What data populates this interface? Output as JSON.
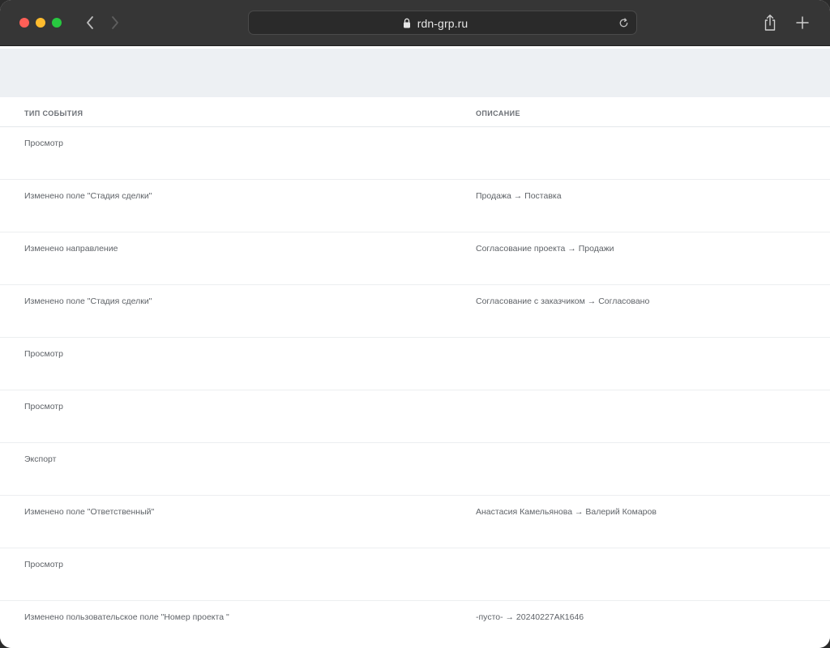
{
  "browser": {
    "url": "rdn-grp.ru"
  },
  "table": {
    "headers": [
      "Тип события",
      "Описание"
    ],
    "rows": [
      {
        "type": "Просмотр",
        "description": ""
      },
      {
        "type": "Изменено поле \"Стадия сделки\"",
        "description": "Продажа → Поставка"
      },
      {
        "type": "Изменено направление",
        "description": "Согласование проекта → Продажи"
      },
      {
        "type": "Изменено поле \"Стадия сделки\"",
        "description": "Согласование с заказчиком → Согласовано"
      },
      {
        "type": "Просмотр",
        "description": ""
      },
      {
        "type": "Просмотр",
        "description": ""
      },
      {
        "type": "Экспорт",
        "description": ""
      },
      {
        "type": "Изменено поле \"Ответственный\"",
        "description": "Анастасия Камельянова → Валерий Комаров"
      },
      {
        "type": "Просмотр",
        "description": ""
      },
      {
        "type": "Изменено пользовательское поле \"Номер проекта \"",
        "description": "-пусто- → 20240227АК1646"
      }
    ]
  }
}
